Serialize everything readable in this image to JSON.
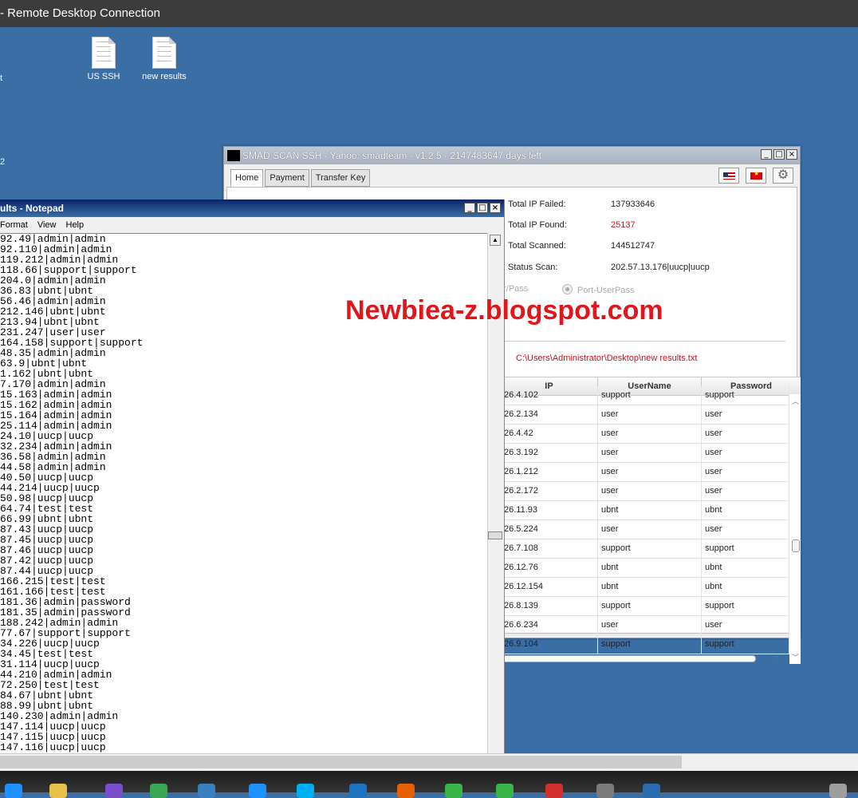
{
  "window": {
    "title": "- Remote Desktop Connection"
  },
  "desktop": {
    "icons": [
      {
        "label": "US SSH"
      },
      {
        "label": "new results"
      }
    ],
    "edge_chars": [
      "t",
      "2"
    ]
  },
  "smad": {
    "title": "SMAD SCAN SSH - Yahoo: smadteam - v1.2.5 - 2147483647 days left",
    "tabs": [
      "Home",
      "Payment",
      "Transfer Key"
    ],
    "stats": [
      {
        "label": "Total IP Failed:",
        "value": "137933646"
      },
      {
        "label": "Total IP Found:",
        "value": "25137"
      },
      {
        "label": "Total Scanned:",
        "value": "144512747"
      },
      {
        "label": "Status Scan:",
        "value": "202.57.13.176|uucp|uucp"
      }
    ],
    "radio_left": "er/Pass",
    "radio_right": "Port-UserPass",
    "path": "C:\\Users\\Administrator\\Desktop\\new results.txt",
    "table": {
      "headers": [
        "IP",
        "UserName",
        "Password"
      ],
      "rows": [
        [
          "26.4.102",
          "support",
          "support"
        ],
        [
          "26.2.134",
          "user",
          "user"
        ],
        [
          "26.4.42",
          "user",
          "user"
        ],
        [
          "26.3.192",
          "user",
          "user"
        ],
        [
          "26.1.212",
          "user",
          "user"
        ],
        [
          "26.2.172",
          "user",
          "user"
        ],
        [
          "26.11.93",
          "ubnt",
          "ubnt"
        ],
        [
          "26.5.224",
          "user",
          "user"
        ],
        [
          "26.7.108",
          "support",
          "support"
        ],
        [
          "26.12.76",
          "ubnt",
          "ubnt"
        ],
        [
          "26.12.154",
          "ubnt",
          "ubnt"
        ],
        [
          "26.8.139",
          "support",
          "support"
        ],
        [
          "26.6.234",
          "user",
          "user"
        ],
        [
          "26.9.104",
          "support",
          "support"
        ]
      ]
    },
    "colors": {
      "found": "#d0121b"
    }
  },
  "notepad": {
    "title": "ults - Notepad",
    "menu": [
      "Format",
      "View",
      "Help"
    ],
    "lines": [
      "92.49|admin|admin",
      "92.110|admin|admin",
      "119.212|admin|admin",
      "118.66|support|support",
      "204.0|admin|admin",
      "36.83|ubnt|ubnt",
      "56.46|admin|admin",
      "212.146|ubnt|ubnt",
      "213.94|ubnt|ubnt",
      "231.247|user|user",
      "164.158|support|support",
      "48.35|admin|admin",
      "63.9|ubnt|ubnt",
      "1.162|ubnt|ubnt",
      "7.170|admin|admin",
      "15.163|admin|admin",
      "15.162|admin|admin",
      "15.164|admin|admin",
      "25.114|admin|admin",
      "24.10|uucp|uucp",
      "32.234|admin|admin",
      "36.58|admin|admin",
      "44.58|admin|admin",
      "40.50|uucp|uucp",
      "44.214|uucp|uucp",
      "50.98|uucp|uucp",
      "64.74|test|test",
      "66.99|ubnt|ubnt",
      "87.43|uucp|uucp",
      "87.45|uucp|uucp",
      "87.46|uucp|uucp",
      "87.42|uucp|uucp",
      "87.44|uucp|uucp",
      "166.215|test|test",
      "161.166|test|test",
      "181.36|admin|password",
      "181.35|admin|password",
      "188.242|admin|admin",
      "77.67|support|support",
      "34.226|uucp|uucp",
      "34.45|test|test",
      "31.114|uucp|uucp",
      "44.210|admin|admin",
      "72.250|test|test",
      "84.67|ubnt|ubnt",
      "88.99|ubnt|ubnt",
      "140.230|admin|admin",
      "147.114|uucp|uucp",
      "147.115|uucp|uucp",
      "147.116|uucp|uucp"
    ]
  },
  "watermark": "Newbiea-z.blogspot.com",
  "taskbar": {
    "icon_names": [
      "edge-icon",
      "folder-icon",
      "vs-icon",
      "chrome-icon",
      "monitor-icon",
      "ie-icon",
      "skype-icon",
      "search-icon",
      "firefox-icon",
      "clover-icon",
      "clover-icon",
      "opera-icon",
      "paint-icon",
      "rdp-icon",
      "app-icon"
    ]
  }
}
